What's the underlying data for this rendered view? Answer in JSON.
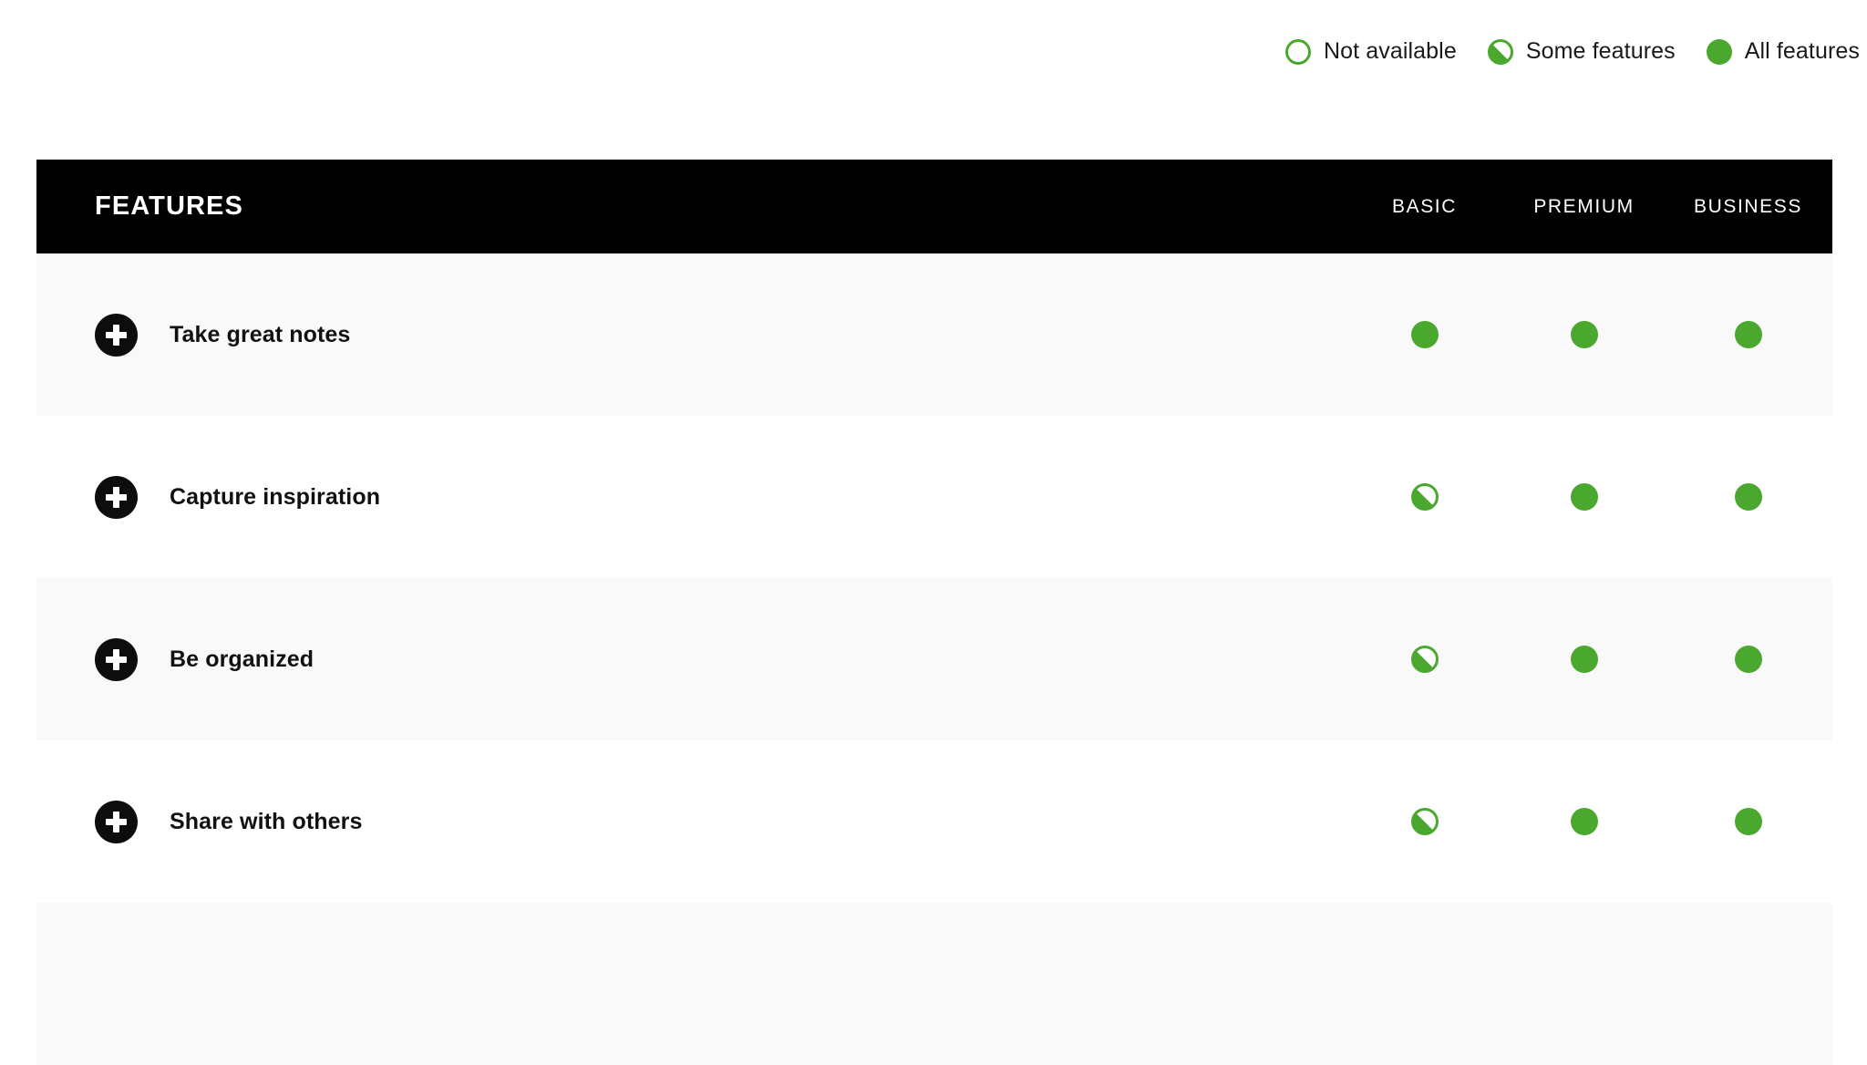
{
  "legend": {
    "items": [
      {
        "icon": "circle-outline-icon",
        "state": "none",
        "label": "Not available"
      },
      {
        "icon": "circle-half-filled-icon",
        "state": "some",
        "label": "Some features"
      },
      {
        "icon": "circle-filled-icon",
        "state": "all",
        "label": "All features"
      }
    ]
  },
  "table": {
    "header": {
      "features_label": "FEATURES",
      "plans": [
        "BASIC",
        "PREMIUM",
        "BUSINESS"
      ]
    },
    "expand_icon": "plus-circle-icon",
    "rows": [
      {
        "label": "Take great notes",
        "basic": "all",
        "premium": "all",
        "business": "all"
      },
      {
        "label": "Capture inspiration",
        "basic": "some",
        "premium": "all",
        "business": "all"
      },
      {
        "label": "Be organized",
        "basic": "some",
        "premium": "all",
        "business": "all"
      },
      {
        "label": "Share with others",
        "basic": "some",
        "premium": "all",
        "business": "all"
      },
      {
        "label": "",
        "basic": "",
        "premium": "",
        "business": ""
      }
    ]
  },
  "colors": {
    "accent_green": "#4ba82e",
    "header_bg": "#000000",
    "row_alt_bg": "#f9f9f9",
    "text_dark": "#111111"
  }
}
